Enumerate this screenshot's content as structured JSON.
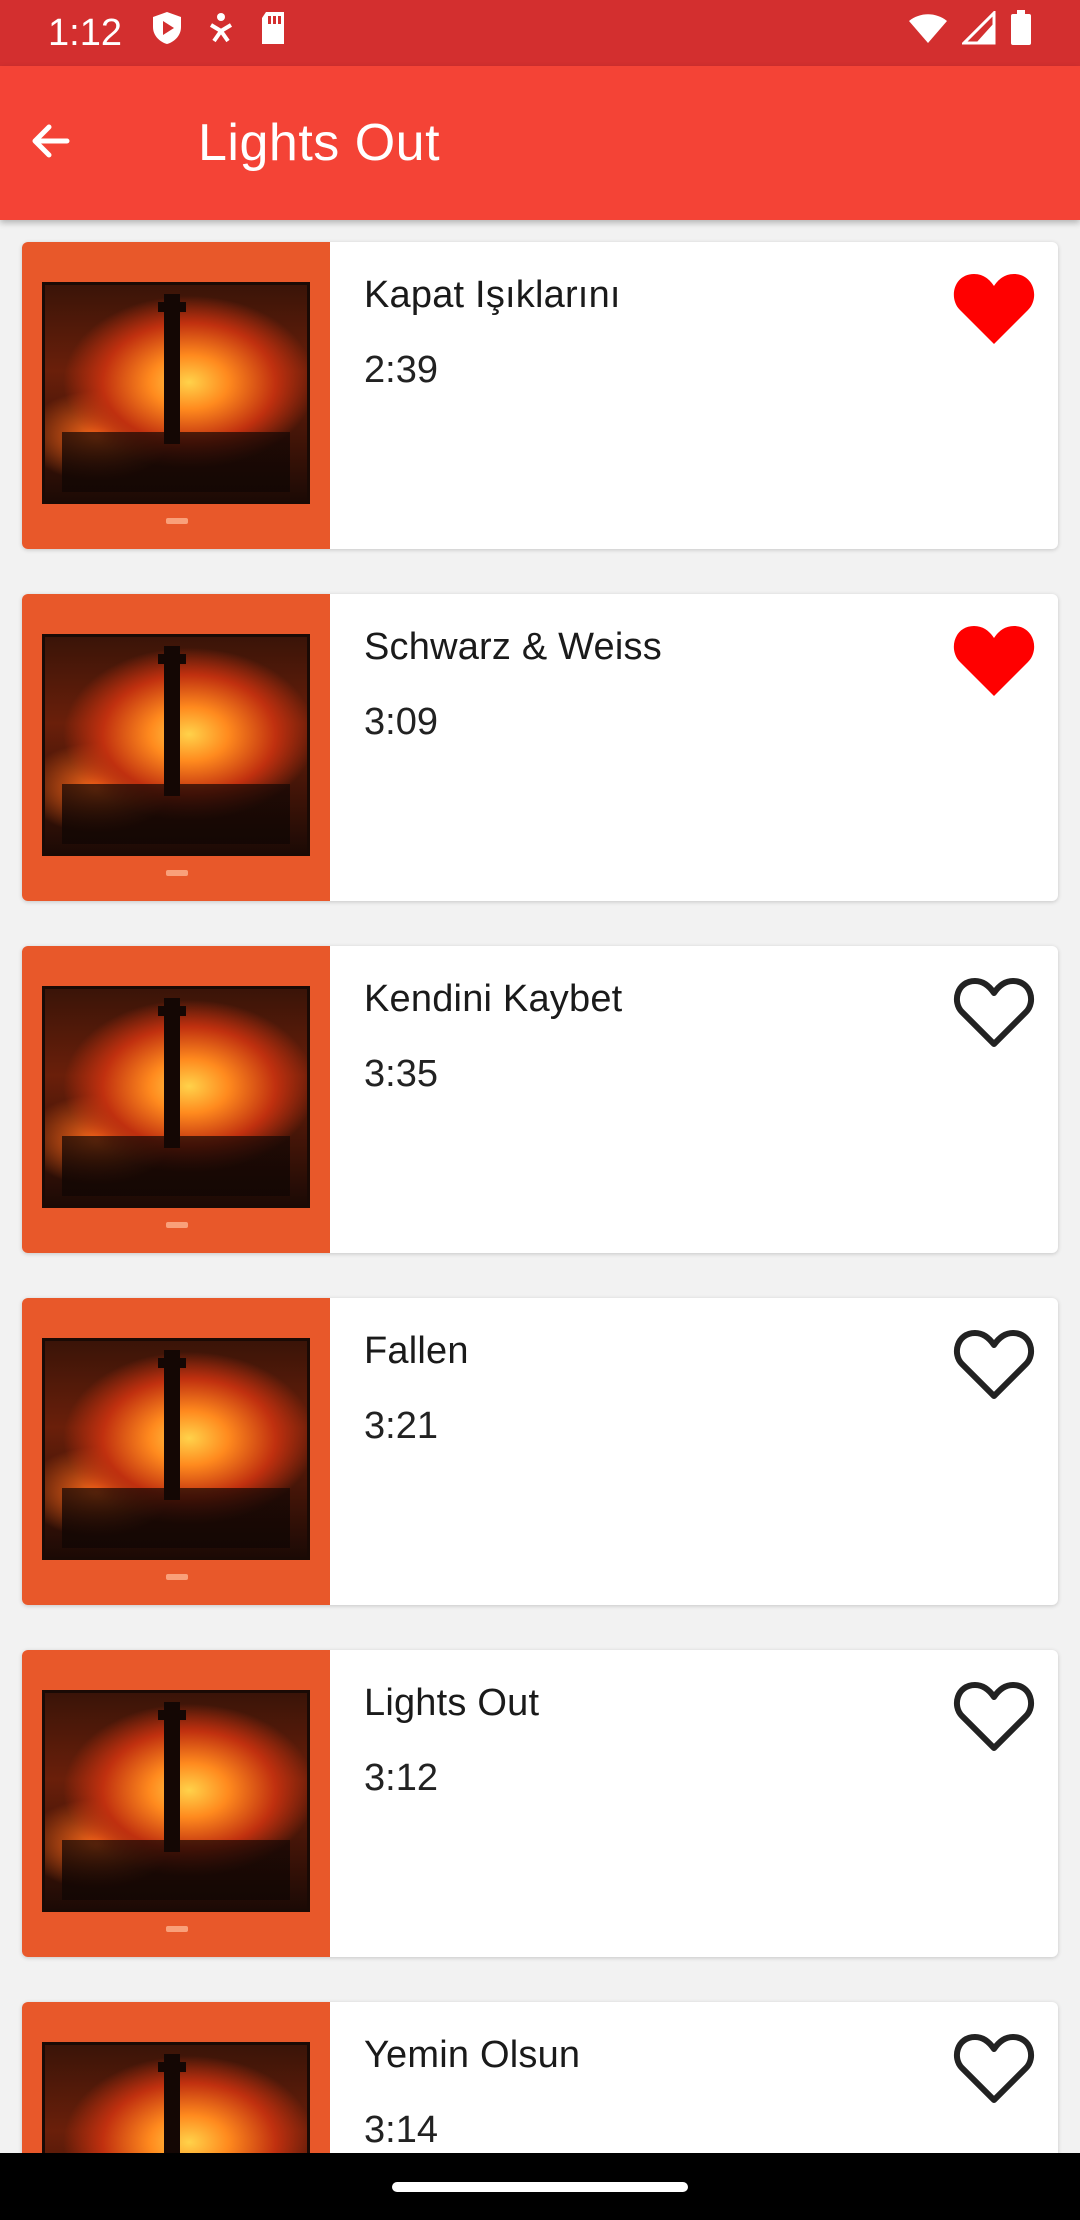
{
  "status_bar": {
    "time": "1:12",
    "left_icons": [
      "play-protect-icon",
      "accessibility-icon",
      "sd-card-icon"
    ],
    "right_icons": [
      "wifi-icon",
      "signal-icon",
      "battery-icon"
    ]
  },
  "app_bar": {
    "title": "Lights Out",
    "back_icon": "arrow-back-icon",
    "color": "#f44336"
  },
  "songs": [
    {
      "title": "Kapat Işıklarını",
      "duration": "2:39",
      "favorite": true
    },
    {
      "title": "Schwarz & Weiss",
      "duration": "3:09",
      "favorite": true
    },
    {
      "title": "Kendini Kaybet",
      "duration": "3:35",
      "favorite": false
    },
    {
      "title": "Fallen",
      "duration": "3:21",
      "favorite": false
    },
    {
      "title": "Lights Out",
      "duration": "3:12",
      "favorite": false
    },
    {
      "title": "Yemin Olsun",
      "duration": "3:14",
      "favorite": false
    }
  ],
  "colors": {
    "status_bar": "#d32f2f",
    "favorite_filled": "#ff0000",
    "favorite_outline": "#222222",
    "cover_background": "#e8582a"
  }
}
